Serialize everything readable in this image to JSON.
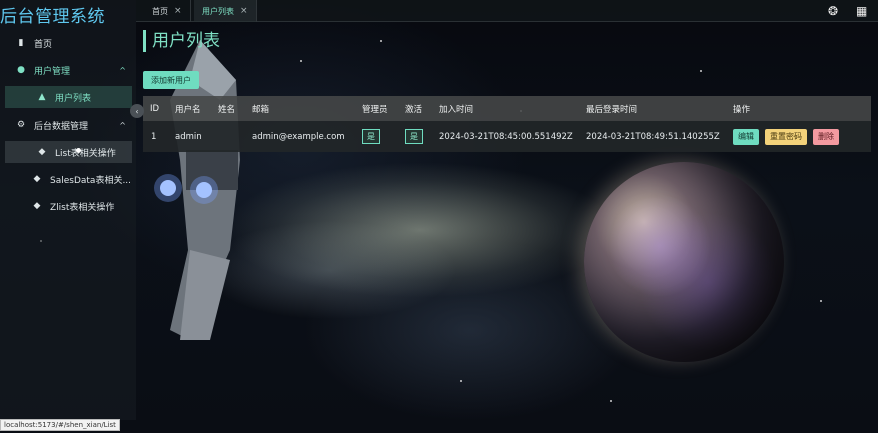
{
  "app": {
    "title": "后台管理系统"
  },
  "sidebar": {
    "items": [
      {
        "label": "首页",
        "icon": "home-icon"
      },
      {
        "label": "用户管理",
        "icon": "android-icon",
        "chevron": "^"
      },
      {
        "label": "用户列表",
        "icon": "warning-icon"
      },
      {
        "label": "后台数据管理",
        "icon": "gear-icon",
        "chevron": "^"
      },
      {
        "label": "List表相关操作",
        "icon": "docker-icon"
      },
      {
        "label": "SalesData表相关...",
        "icon": "docker-icon"
      },
      {
        "label": "Zlist表相关操作",
        "icon": "docker-icon"
      }
    ],
    "collapse_glyph": "‹"
  },
  "tabs": [
    {
      "label": "首页",
      "close": "×"
    },
    {
      "label": "用户列表",
      "close": "×"
    }
  ],
  "page": {
    "title": "用户列表",
    "add_button": "添加新用户"
  },
  "table": {
    "headers": [
      "ID",
      "用户名",
      "姓名",
      "邮箱",
      "管理员",
      "激活",
      "加入时间",
      "最后登录时间",
      "操作"
    ],
    "rows": [
      {
        "id": "1",
        "username": "admin",
        "name": "",
        "email": "admin@example.com",
        "is_admin": "是",
        "is_active": "是",
        "joined": "2024-03-21T08:45:00.551492Z",
        "last_login": "2024-03-21T08:49:51.140255Z",
        "actions": {
          "edit": "编辑",
          "reset": "重置密码",
          "delete": "删除"
        }
      }
    ]
  },
  "status_bar": {
    "url": "localhost:5173/#/shen_xian/List"
  },
  "colors": {
    "accent": "#6fdcc0",
    "brand": "#5fc8ef",
    "warning": "#f3d27a",
    "danger": "#f49aa0"
  }
}
